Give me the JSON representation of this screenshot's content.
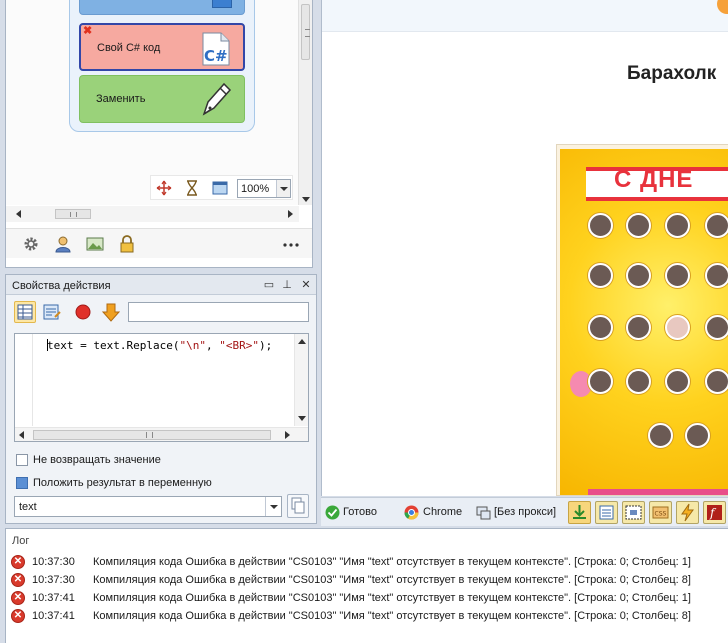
{
  "canvas": {
    "blocks": [
      {
        "label": "Свой C# код",
        "icon": "csharp-icon",
        "state": "error"
      },
      {
        "label": "Заменить",
        "icon": "pen-icon"
      }
    ],
    "zoom": "100%"
  },
  "props": {
    "title": "Свойства действия",
    "code": {
      "part1": "text = text.Replace(",
      "str1": "\"\\n\"",
      "sep": ", ",
      "str2": "\"<BR>\"",
      "part2": ");"
    },
    "no_return_label": "Не возвращать значение",
    "put_result_label": "Положить результат в переменную",
    "variable": "text"
  },
  "browser": {
    "heading": "Барахолк",
    "poster_banner": "С ДНЕ",
    "accent_orange": "#f6a13a"
  },
  "statusbar": {
    "ready": "Готово",
    "browser": "Chrome",
    "proxy": "[Без прокси]"
  },
  "log": {
    "title": "Лог",
    "rows": [
      {
        "time": "10:37:30",
        "message": "Компиляция кода  Ошибка в действии \"CS0103\" \"Имя \"text\" отсутствует в текущем контексте\". [Строка: 0; Столбец: 1]"
      },
      {
        "time": "10:37:30",
        "message": "Компиляция кода  Ошибка в действии \"CS0103\" \"Имя \"text\" отсутствует в текущем контексте\". [Строка: 0; Столбец: 8]"
      },
      {
        "time": "10:37:41",
        "message": "Компиляция кода  Ошибка в действии \"CS0103\" \"Имя \"text\" отсутствует в текущем контексте\". [Строка: 0; Столбец: 1]"
      },
      {
        "time": "10:37:41",
        "message": "Компиляция кода  Ошибка в действии \"CS0103\" \"Имя \"text\" отсутствует в текущем контексте\". [Строка: 0; Столбец: 8]"
      }
    ]
  },
  "colors": {
    "error_red": "#d93a2c",
    "block_csharp": "#f6a9a0",
    "block_replace": "#9ad27a",
    "selection_border": "#3247a8"
  }
}
